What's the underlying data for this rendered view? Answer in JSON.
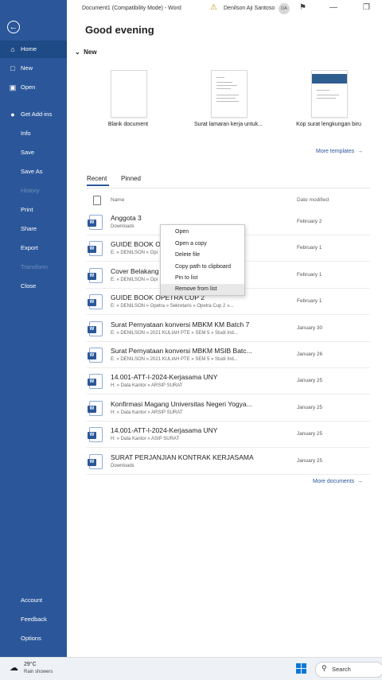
{
  "titlebar": {
    "document": "Document1 (Compatibility Mode)  -  Word",
    "user": "Denilson Aji Santoso",
    "initials": "DA"
  },
  "greeting": "Good evening",
  "sidebar": {
    "items": [
      {
        "label": "Home",
        "icon": "home-icon"
      },
      {
        "label": "New",
        "icon": "new-document-icon"
      },
      {
        "label": "Open",
        "icon": "folder-open-icon"
      },
      {
        "label": "Get Add-ins",
        "icon": "addin-icon"
      },
      {
        "label": "Info"
      },
      {
        "label": "Save"
      },
      {
        "label": "Save As"
      },
      {
        "label": "History"
      },
      {
        "label": "Print"
      },
      {
        "label": "Share"
      },
      {
        "label": "Export"
      },
      {
        "label": "Transform"
      },
      {
        "label": "Close"
      }
    ],
    "bottom": [
      {
        "label": "Account"
      },
      {
        "label": "Feedback"
      },
      {
        "label": "Options"
      }
    ]
  },
  "new_section": {
    "header": "New",
    "templates": [
      {
        "label": "Blank document"
      },
      {
        "label": "Surat lamaran kerja untuk..."
      },
      {
        "label": "Kop surat lengkungan biru"
      }
    ],
    "more": "More templates"
  },
  "tabs": [
    "Recent",
    "Pinned"
  ],
  "columns": {
    "name": "Name",
    "date": "Date modified"
  },
  "files": [
    {
      "name": "Anggota 3",
      "path": "Downloads",
      "date": "February 2"
    },
    {
      "name": "GUIDE BOOK OF",
      "path": "E: » DENILSON » Opi",
      "date": "February 1"
    },
    {
      "name": "Cover Belakang",
      "path": "E: » DENILSON » Opi",
      "date": "February 1"
    },
    {
      "name": "GUIDE BOOK OPETRA CUP 2",
      "path": "E: » DENILSON » Opetra » Sekretaris » Opetra Cup 2 »...",
      "date": "February 1"
    },
    {
      "name": "Surat Pernyataan konversi MBKM KM Batch 7",
      "path": "E: » DENILSON » 2021 KULIAH PTE » SEM 5 » Studi Ind...",
      "date": "January 30"
    },
    {
      "name": "Surat Pernyataan konversi MBKM MSIB Batc...",
      "path": "E: » DENILSON » 2021 KULIAH PTE » SEM 5 » Studi Ind...",
      "date": "January 26"
    },
    {
      "name": "14.001-ATT-I-2024-Kerjasama UNY",
      "path": "H: » Data Kantor » ARSIP SURAT",
      "date": "January 25"
    },
    {
      "name": "Konfirmasi Magang Universitas Negeri Yogya...",
      "path": "H: » Data Kantor » ARSIP SURAT",
      "date": "January 25"
    },
    {
      "name": "14.001-ATT-I-2024-Kerjasama UNY",
      "path": "H: » Data Kantor » ASIP SURAT",
      "date": "January 25"
    },
    {
      "name": "SURAT PERJANJIAN KONTRAK KERJASAMA",
      "path": "Downloads",
      "date": "January 25"
    }
  ],
  "more_documents": "More documents",
  "context_menu": [
    "Open",
    "Open a copy",
    "Delete file",
    "Copy path to clipboard",
    "Pin to list",
    "Remove from list"
  ],
  "taskbar": {
    "temp": "29°C",
    "condition": "Rain showers",
    "search": "Search"
  },
  "colors": {
    "accent": "#2b579a"
  }
}
